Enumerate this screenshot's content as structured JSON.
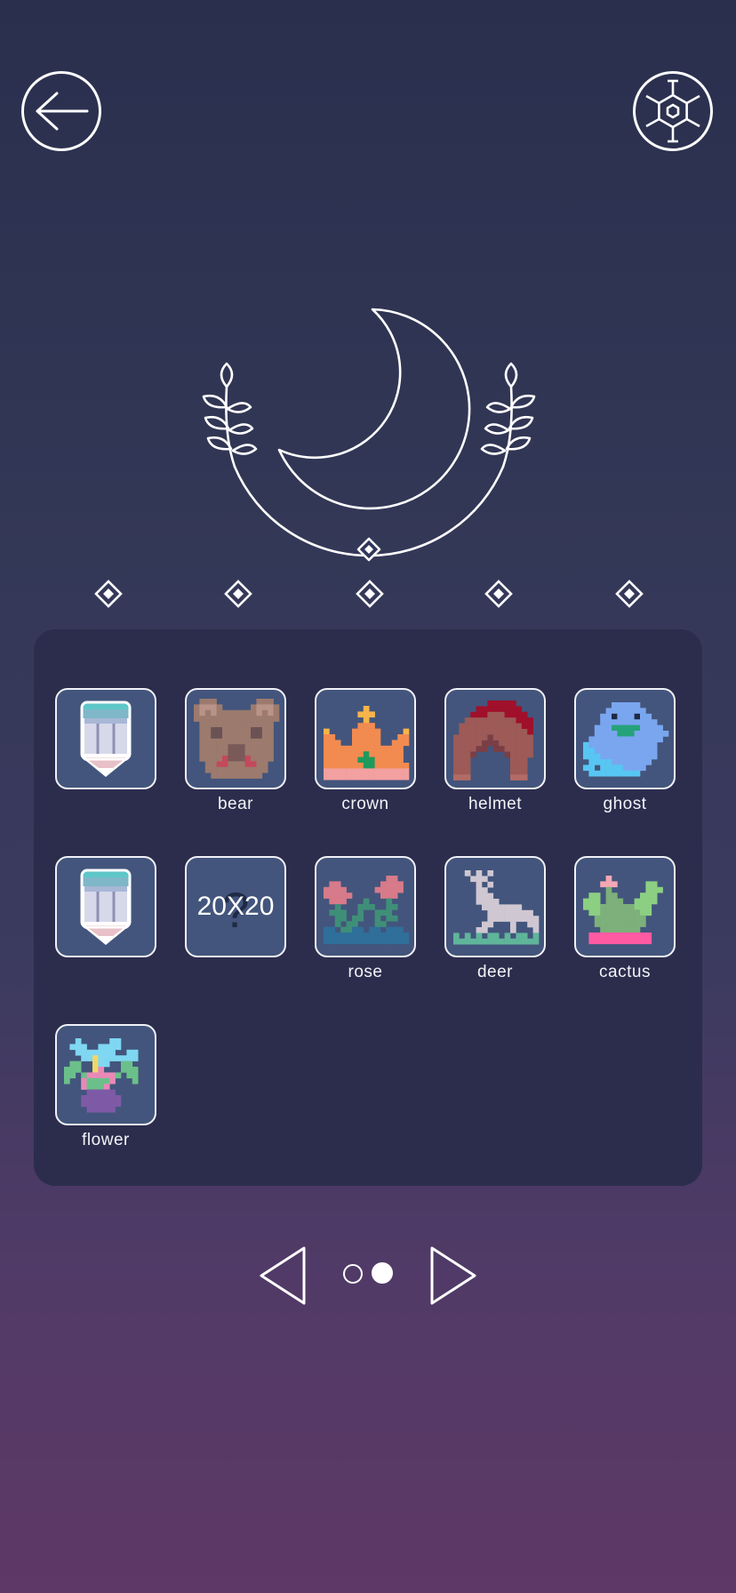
{
  "header": {
    "back_icon": "arrow-left-icon",
    "settings_icon": "hexagon-gear-icon"
  },
  "emblem": {
    "icon": "crescent-moon-laurel-icon"
  },
  "level_markers": {
    "count": 5,
    "icon": "diamond-icon"
  },
  "grid": {
    "items": [
      {
        "label": "",
        "icon": "pencil-create-icon",
        "type": "create"
      },
      {
        "label": "bear",
        "icon": "bear-pixel-art",
        "type": "puzzle"
      },
      {
        "label": "crown",
        "icon": "crown-pixel-art",
        "type": "puzzle"
      },
      {
        "label": "helmet",
        "icon": "helmet-pixel-art",
        "type": "puzzle"
      },
      {
        "label": "ghost",
        "icon": "ghost-pixel-art",
        "type": "puzzle"
      },
      {
        "label": "",
        "icon": "pencil-create-icon",
        "type": "create"
      },
      {
        "label": "",
        "icon": "question-mark-icon",
        "type": "unknown",
        "size_text": "20X20",
        "glyph": "?"
      },
      {
        "label": "rose",
        "icon": "rose-pixel-art",
        "type": "puzzle"
      },
      {
        "label": "deer",
        "icon": "deer-pixel-art",
        "type": "puzzle"
      },
      {
        "label": "cactus",
        "icon": "cactus-pixel-art",
        "type": "puzzle"
      },
      {
        "label": "flower",
        "icon": "flower-pixel-art",
        "type": "puzzle"
      }
    ]
  },
  "pagination": {
    "prev_icon": "triangle-left-icon",
    "next_icon": "triangle-right-icon",
    "pages": 2,
    "current_page": 2
  },
  "colors": {
    "background_top": "#2a2f4e",
    "background_bottom": "#5e3866",
    "panel": "#2c2d4d",
    "tile": "#43557c",
    "outline": "#ffffff"
  }
}
